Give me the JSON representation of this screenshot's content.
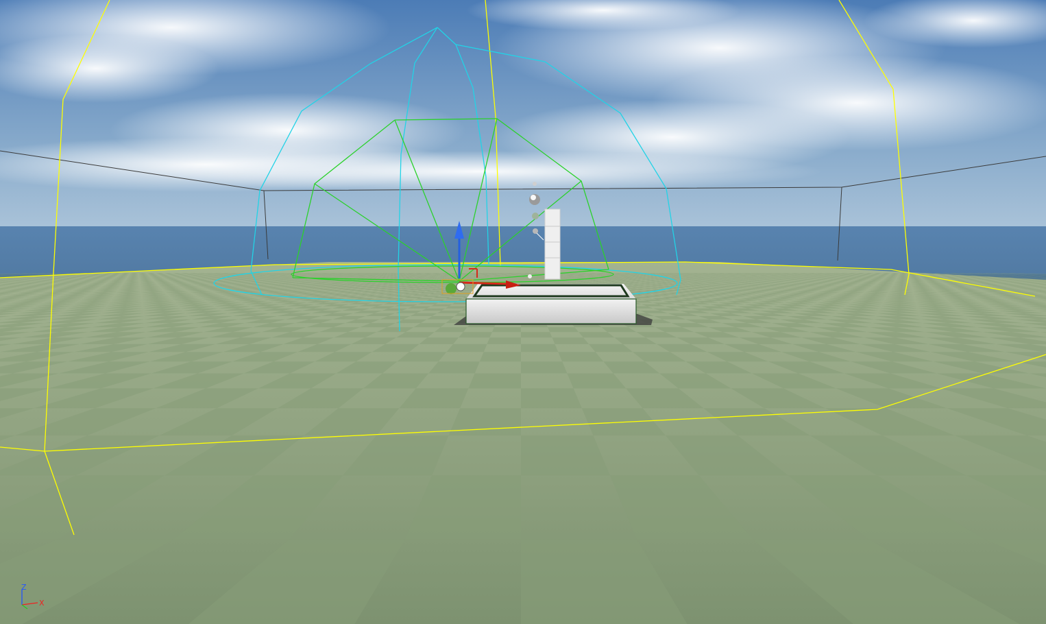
{
  "viewport": {
    "sky_colors": [
      "#4f7fb8",
      "#7aa3cc",
      "#c7d6e2"
    ],
    "floor_colors": [
      "#9aab86",
      "#7f9470"
    ],
    "wire_colors": {
      "sky_light_bounds": "#ffff00",
      "attenuation_sphere": "#22d3e6",
      "light_cone": "#2bd12b",
      "box_outline": "#3a3a3a"
    }
  },
  "axis_indicator": {
    "z_label": "Z",
    "x_label": "X",
    "z_color": "#2255ff",
    "x_color": "#ee2222",
    "y_color": "#22cc22"
  },
  "objects": {
    "platform": "white-platform",
    "pillar": "white-pillar",
    "transform_gizmo": "transform-gizmo"
  }
}
